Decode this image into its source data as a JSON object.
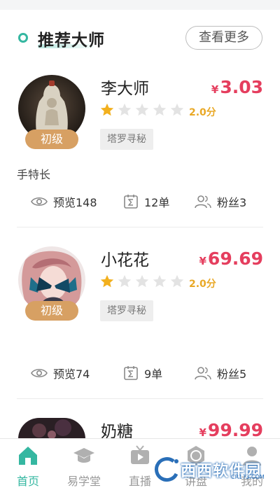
{
  "section": {
    "title": "推荐大师",
    "more_label": "查看更多"
  },
  "masters": [
    {
      "name": "李大师",
      "currency": "¥",
      "price": "3.03",
      "level": "初级",
      "rating": "2.0分",
      "stars_filled": 1,
      "stars_total": 5,
      "tag": "塔罗寻秘",
      "description": "手特长",
      "views": "预览148",
      "orders": "12单",
      "fans": "粉丝3"
    },
    {
      "name": "小花花",
      "currency": "¥",
      "price": "69.69",
      "level": "初级",
      "rating": "2.0分",
      "stars_filled": 1,
      "stars_total": 5,
      "tag": "塔罗寻秘",
      "description": "",
      "views": "预览74",
      "orders": "9单",
      "fans": "粉丝5"
    },
    {
      "name": "奶糖",
      "currency": "¥",
      "price": "99.99"
    }
  ],
  "tabbar": {
    "items": [
      {
        "label": "首页",
        "icon": "home-icon",
        "active": true
      },
      {
        "label": "易学堂",
        "icon": "graduation-cap-icon",
        "active": false
      },
      {
        "label": "直播",
        "icon": "tv-icon",
        "active": false
      },
      {
        "label": "讲盘",
        "icon": "compass-icon",
        "active": false
      },
      {
        "label": "我的",
        "icon": "user-icon",
        "active": false
      }
    ]
  },
  "watermark": {
    "text": "西西软件园",
    "sub": "CR173.COM"
  },
  "colors": {
    "accent": "#35b7a1",
    "price": "#e53e5e",
    "star": "#f2b01e",
    "badge": "#d7a063"
  }
}
